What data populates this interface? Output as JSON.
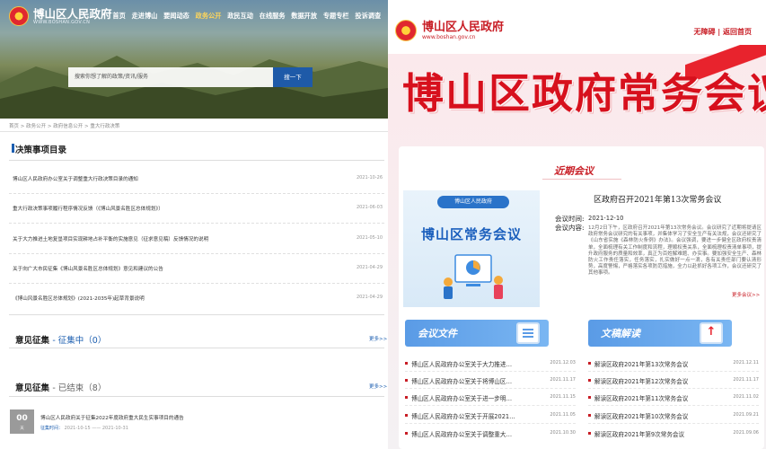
{
  "left": {
    "site_name": "博山区人民政府",
    "site_url": "WWW.BOSHAN.GOV.CN",
    "nav": [
      "首页",
      "走进博山",
      "要闻动态",
      "政务公开",
      "政民互动",
      "在线服务",
      "数据开放",
      "专题专栏",
      "投诉调查"
    ],
    "search_placeholder": "搜索你想了解的政策/资讯/服务",
    "search_button": "搜一下",
    "breadcrumb": "首页 > 政务公开 > 政府信息公开 > 重大行政决策",
    "decisions_title": "决策事项目录",
    "decisions": [
      {
        "text": "博山区人民政府办公室关于调整重大行政决策目录的通知",
        "date": "2021-10-26"
      },
      {
        "text": "重大行政决策事项履行程序情况反馈（《博山风景名胜区总体规划》）",
        "date": "2021-06-03"
      },
      {
        "text": "关于大力推进土地复垦项目实现耕地占补平衡的实施意见（征求意见稿）反馈情况的说明",
        "date": "2021-05-10"
      },
      {
        "text": "关于向广大市民征集《博山风景名胜区总体规划》意见和建议的公告",
        "date": "2021-04-29"
      },
      {
        "text": "《博山风景名胜区总体规划》(2021-2035年)起草背景说明",
        "date": "2021-04-29"
      }
    ],
    "opinion_active_title": "意见征集",
    "opinion_active_status": "- 征集中（0）",
    "opinion_closed_title": "意见征集",
    "opinion_closed_status": "- 已结束（8）",
    "more": "更多>>",
    "opinion_day": "00",
    "opinion_day_sub": "天",
    "opinion_item": "博山区人民政府关于征集2022年度政府重大民生实事项目的通告",
    "opinion_label": "征集时间：",
    "opinion_time": "2021-10-15 —— 2021-10-31"
  },
  "right": {
    "site_name": "博山区人民政府",
    "site_url": "www.boshan.gov.cn",
    "top_links": "无障碍  |  返回首页",
    "hero_title": "博山区政府常务会议",
    "recent_label": "近期会议",
    "poster_badge": "博山区人民政府",
    "poster_title": "博山区常务会议",
    "meeting_title": "区政府召开2021年第13次常务会议",
    "time_label": "会议时间:",
    "time_value": "2021-12-10",
    "content_label": "会议内容:",
    "content_text": "12月2日下午，区政府召开2021年第13次常务会议。会议研究了近期将提请区政府常务会议研究的有关事项，并集体学习了安全生产有关法规，会议还研究了《山东省实施《森林防火条例》办法》。会议强调，要进一步健全区政府权责清单，全面梳理有关工作制度和流程，理顺权责关系，全面梳理权责清单事项，提升政府服务的质量和效率，真正为百姓解难题、办实事。要加强安全生产、森林防火工作责任落实，任务落实，扎实做好一点一滴，各有关责任部门要认清形势，高度警惕，严格落实各项防范措施，全力以赴抓好各项工作，会议还研究了其他事项。",
    "more": "更多会议>>",
    "tab_docs": "会议文件",
    "tab_interp": "文稿解读",
    "docs": [
      {
        "text": "博山区人民政府办公室关于大力推进…",
        "date": "2021.12.03"
      },
      {
        "text": "博山区人民政府办公室关于将博山区…",
        "date": "2021.11.17"
      },
      {
        "text": "博山区人民政府办公室关于进一步明…",
        "date": "2021.11.15"
      },
      {
        "text": "博山区人民政府办公室关于开展2021…",
        "date": "2021.11.05"
      },
      {
        "text": "博山区人民政府办公室关于调整重大…",
        "date": "2021.10.30"
      }
    ],
    "interp": [
      {
        "text": "解读区政府2021年第13次常务会议",
        "date": "2021.12.11"
      },
      {
        "text": "解读区政府2021年第12次常务会议",
        "date": "2021.11.17"
      },
      {
        "text": "解读区政府2021年第11次常务会议",
        "date": "2021.11.02"
      },
      {
        "text": "解读区政府2021年第10次常务会议",
        "date": "2021.09.21"
      },
      {
        "text": "解读区政府2021年第9次常务会议",
        "date": "2021.09.06"
      }
    ]
  }
}
